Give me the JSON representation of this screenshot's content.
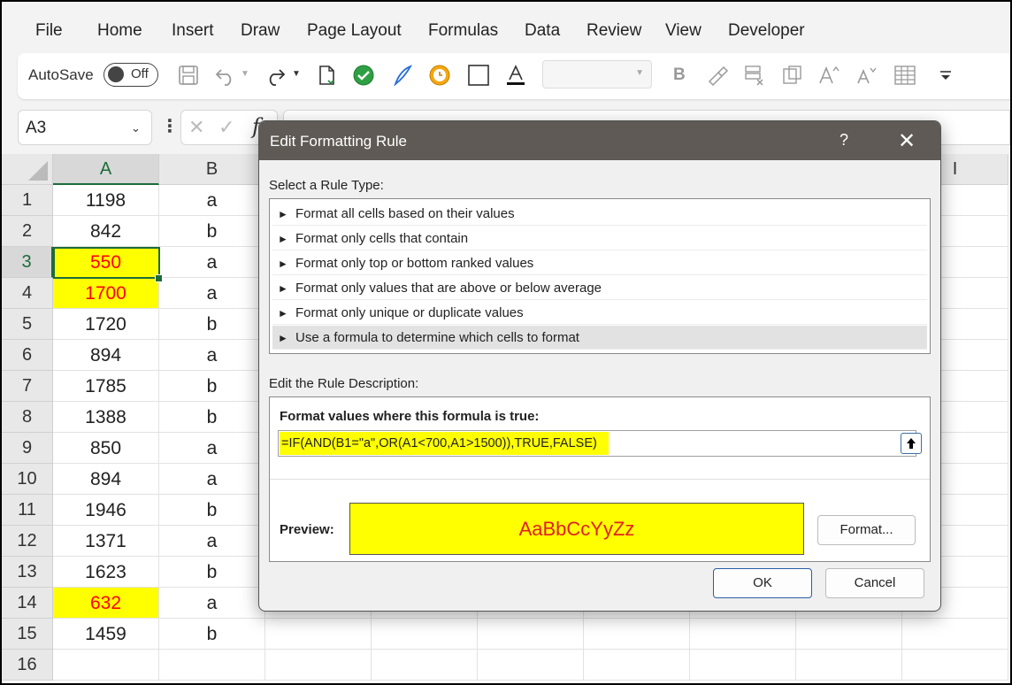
{
  "menu": [
    "File",
    "Home",
    "Insert",
    "Draw",
    "Page Layout",
    "Formulas",
    "Data",
    "Review",
    "View",
    "Developer"
  ],
  "toolbar": {
    "autosave_label": "AutoSave",
    "autosave_state": "Off",
    "icons": [
      "save-icon",
      "undo-icon",
      "redo-icon",
      "new-doc-icon",
      "check-icon",
      "pen-icon",
      "clock-icon",
      "border-icon",
      "font-color-icon",
      "bold-icon",
      "format-painter-icon",
      "clear-format-icon",
      "paste-icon",
      "increase-font-icon",
      "decrease-font-icon",
      "table-icon",
      "more-icon"
    ],
    "bold_label": "B"
  },
  "formula_bar": {
    "name_box": "A3",
    "fx": "f"
  },
  "grid": {
    "columns": [
      "A",
      "B",
      "",
      "",
      "",
      "",
      "",
      "",
      "I"
    ],
    "rows": [
      {
        "n": "1",
        "a": "1198",
        "b": "a",
        "hl": false
      },
      {
        "n": "2",
        "a": "842",
        "b": "b",
        "hl": false
      },
      {
        "n": "3",
        "a": "550",
        "b": "a",
        "hl": true
      },
      {
        "n": "4",
        "a": "1700",
        "b": "a",
        "hl": true
      },
      {
        "n": "5",
        "a": "1720",
        "b": "b",
        "hl": false
      },
      {
        "n": "6",
        "a": "894",
        "b": "a",
        "hl": false
      },
      {
        "n": "7",
        "a": "1785",
        "b": "b",
        "hl": false
      },
      {
        "n": "8",
        "a": "1388",
        "b": "b",
        "hl": false
      },
      {
        "n": "9",
        "a": "850",
        "b": "a",
        "hl": false
      },
      {
        "n": "10",
        "a": "894",
        "b": "a",
        "hl": false
      },
      {
        "n": "11",
        "a": "1946",
        "b": "b",
        "hl": false
      },
      {
        "n": "12",
        "a": "1371",
        "b": "a",
        "hl": false
      },
      {
        "n": "13",
        "a": "1623",
        "b": "b",
        "hl": false
      },
      {
        "n": "14",
        "a": "632",
        "b": "a",
        "hl": true
      },
      {
        "n": "15",
        "a": "1459",
        "b": "b",
        "hl": false
      },
      {
        "n": "16",
        "a": "",
        "b": "",
        "hl": false
      }
    ],
    "highlight_color": "#ffff00",
    "highlight_text_color": "#ff0000"
  },
  "dialog": {
    "title": "Edit Formatting Rule",
    "help": "?",
    "close": "✕",
    "select_label": "Select a Rule Type:",
    "rule_types": [
      "Format all cells based on their values",
      "Format only cells that contain",
      "Format only top or bottom ranked values",
      "Format only values that are above or below average",
      "Format only unique or duplicate values",
      "Use a formula to determine which cells to format"
    ],
    "selected_rule_index": 5,
    "edit_label": "Edit the Rule Description:",
    "formula_heading": "Format values where this formula is true:",
    "formula": "=IF(AND(B1=\"a\",OR(A1<700,A1>1500)),TRUE,FALSE)",
    "preview_label": "Preview:",
    "preview_text": "AaBbCcYyZz",
    "format_button": "Format...",
    "ok_button": "OK",
    "cancel_button": "Cancel"
  }
}
